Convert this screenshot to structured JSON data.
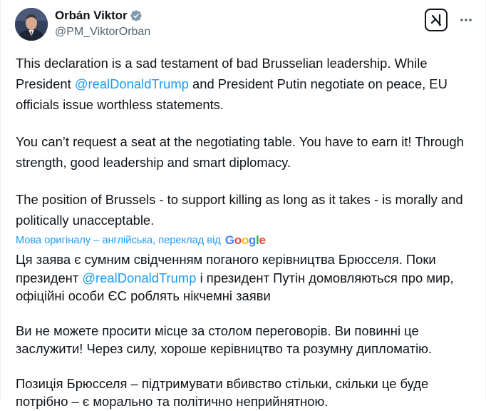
{
  "author": {
    "display_name": "Orbán Viktor",
    "handle": "@PM_ViktorOrban",
    "verified_icon": "verified-badge-icon"
  },
  "actions": {
    "grok_icon": "grok-icon",
    "more_icon": "more-options-icon"
  },
  "tweet_en": {
    "p1_part1": "This declaration is a sad testament of bad Brusselian leadership. While President ",
    "p1_mention": "@realDonaldTrump",
    "p1_part2": " and President Putin negotiate on peace, EU officials issue worthless statements.",
    "p2": "You can’t request a seat at the negotiating table. You have to earn it! Through strength, good leadership and smart diplomacy.",
    "p3": "The position of Brussels - to support killing as long as it takes - is morally and politically unacceptable."
  },
  "translation": {
    "label": "Мова оригіналу – англійська, переклад від",
    "provider": "Google",
    "provider_colors": [
      "#4285F4",
      "#EA4335",
      "#FBBC05",
      "#4285F4",
      "#34A853",
      "#EA4335"
    ]
  },
  "tweet_uk": {
    "p1_part1": "Ця заява є сумним свідченням поганого керівництва Брюсселя. Поки президент ",
    "p1_mention": "@realDonaldTrump",
    "p1_part2": " і президент Путін домовляються про мир, офіційні особи ЄС роблять нікчемні заяви",
    "p2": "Ви не можете просити місце за столом переговорів. Ви повинні це заслужити! Через силу, хороше керівництво та розумну дипломатію.",
    "p3": "Позиція Брюсселя – підтримувати вбивство стільки, скільки це буде потрібно – є морально та політично неприйнятною."
  },
  "colors": {
    "link": "#1d9bf0",
    "text": "#0f1419",
    "secondary": "#536471"
  }
}
